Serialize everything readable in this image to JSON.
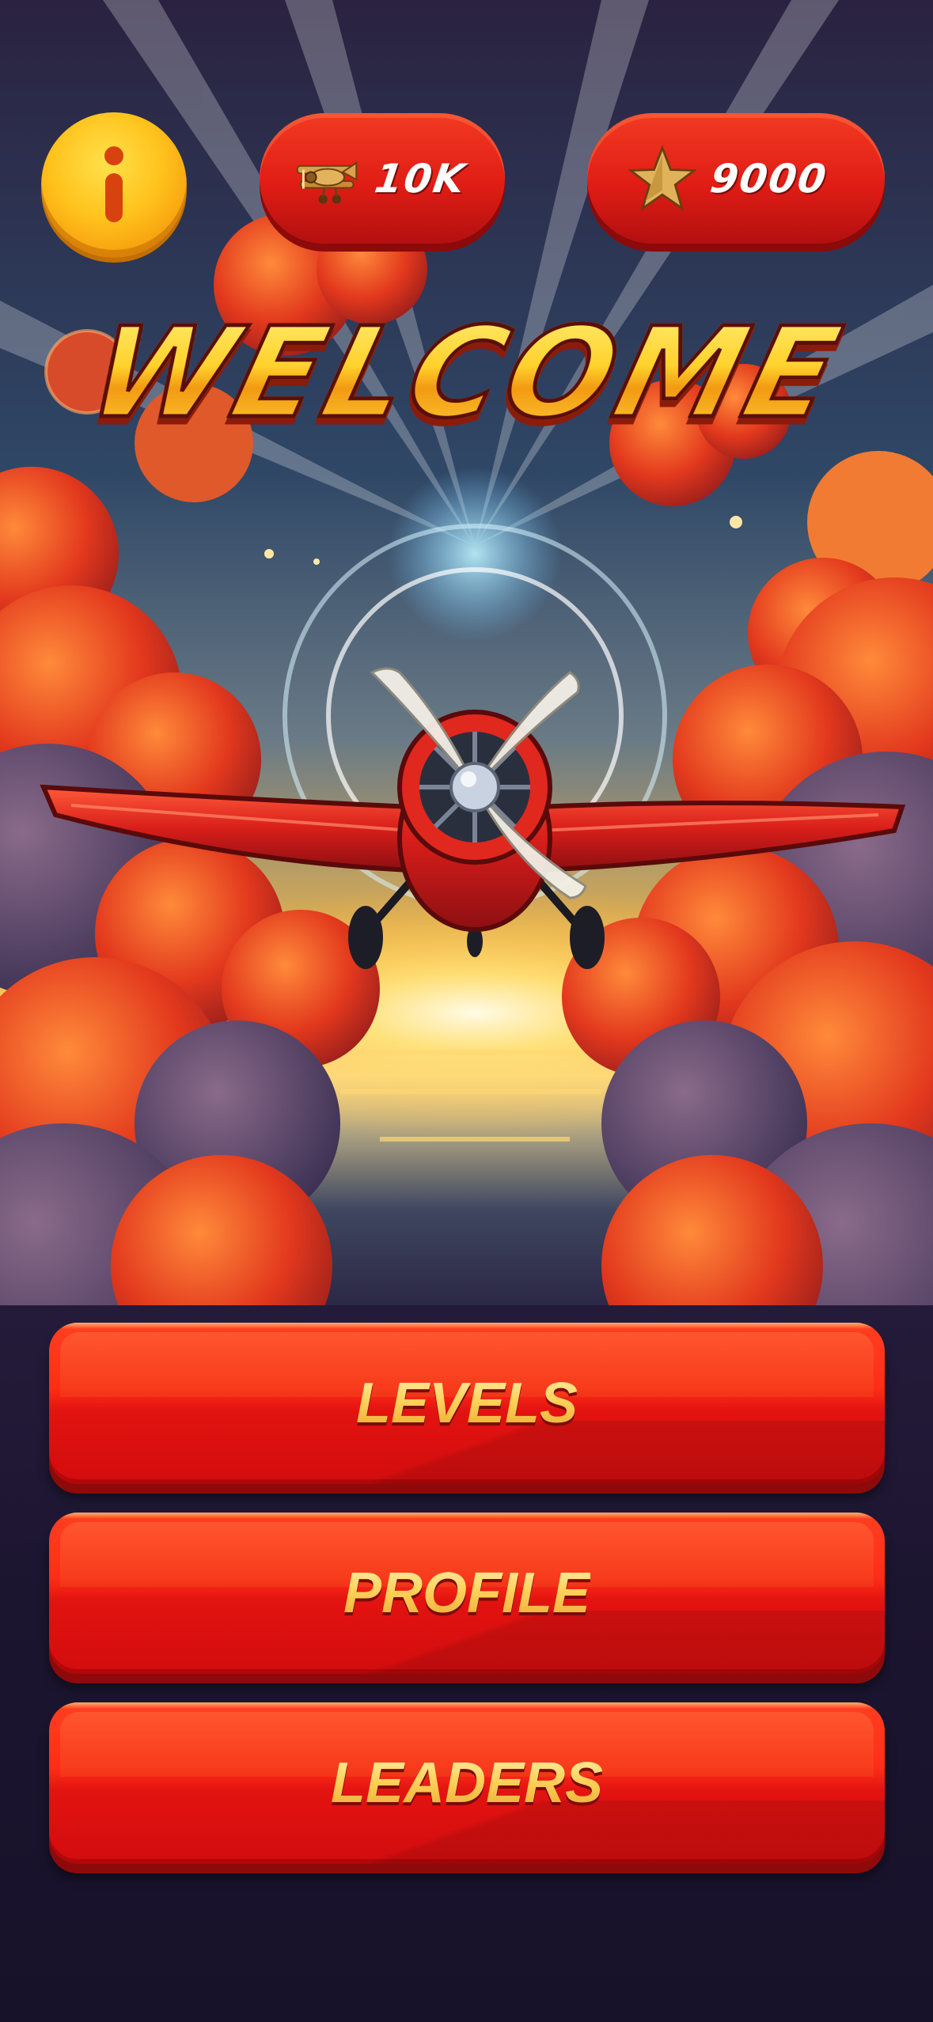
{
  "header": {
    "info_icon": "info-icon",
    "planes": {
      "icon": "biplane-icon",
      "value": "10K"
    },
    "stars": {
      "icon": "star-icon",
      "value": "9000"
    }
  },
  "title": "WELCOME",
  "menu": [
    {
      "label": "LEVELS"
    },
    {
      "label": "PROFILE"
    },
    {
      "label": "LEADERS"
    }
  ],
  "colors": {
    "accent_red": "#e21310",
    "gold": "#ffc21c",
    "background": "#1b1530"
  }
}
